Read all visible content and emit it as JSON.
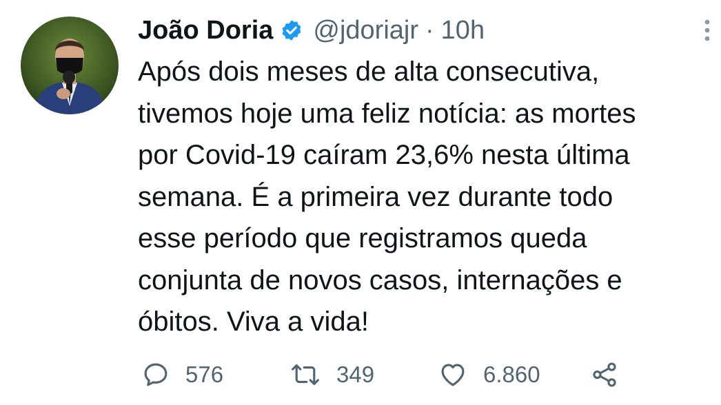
{
  "tweet": {
    "display_name": "João Doria",
    "verified_icon": "verified-badge-icon",
    "handle": "@jdoriajr",
    "separator": "·",
    "time": "10h",
    "text": "Após dois meses de alta consecutiva,\ntivemos hoje uma feliz notícia: as mortes\npor Covid-19 caíram 23,6% nesta última\nsemana. É a primeira vez durante todo\nesse período que registramos queda\nconjunta de novos casos, internações e\nóbitos. Viva a vida!",
    "actions": {
      "reply": {
        "icon": "reply-icon",
        "count": "576"
      },
      "retweet": {
        "icon": "retweet-icon",
        "count": "349"
      },
      "like": {
        "icon": "heart-icon",
        "count": "6.860"
      },
      "share": {
        "icon": "share-icon"
      }
    }
  },
  "colors": {
    "text": "#0f1419",
    "secondary": "#536471",
    "verified": "#1d9bf0",
    "background": "#ffffff"
  }
}
